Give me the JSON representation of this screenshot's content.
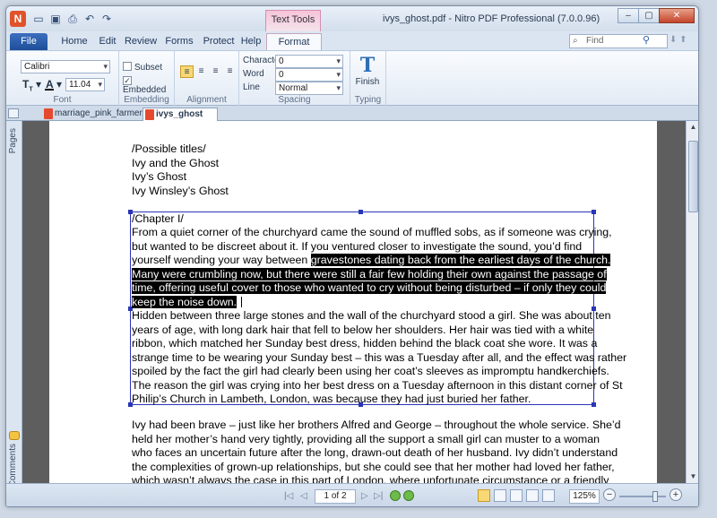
{
  "window": {
    "title": "ivys_ghost.pdf - Nitro PDF Professional (7.0.0.96)",
    "context_tab_header": "Text Tools",
    "controls": [
      "–",
      "▢",
      "✕"
    ]
  },
  "quick_access": [
    "folder-icon",
    "save-icon",
    "print-icon",
    "undo-icon",
    "redo-icon"
  ],
  "ribbon_tabs": [
    {
      "label": "File"
    },
    {
      "label": "Home"
    },
    {
      "label": "Edit"
    },
    {
      "label": "Review"
    },
    {
      "label": "Forms"
    },
    {
      "label": "Protect"
    },
    {
      "label": "Help"
    },
    {
      "label": "Format"
    }
  ],
  "search": {
    "placeholder": "Find"
  },
  "ribbon": {
    "font": {
      "name": "Calibri",
      "size": "11.04",
      "label": "Font"
    },
    "embedding": {
      "subset": "Subset",
      "embedded": "Embedded",
      "label": "Embedding"
    },
    "alignment": {
      "label": "Alignment"
    },
    "spacing": {
      "character_label": "Character",
      "character_value": "0",
      "word_label": "Word",
      "word_value": "0",
      "line_label": "Line",
      "line_value": "Normal",
      "label": "Spacing"
    },
    "typing": {
      "finish": "Finish",
      "label": "Typing"
    }
  },
  "doc_tabs": [
    {
      "label": "marriage_pink_farmer"
    },
    {
      "label": "ivys_ghost"
    }
  ],
  "side_panel": {
    "pages": "Pages",
    "comments": "Comments"
  },
  "document": {
    "lines": [
      {
        "text": "/Possible titles/"
      },
      {
        "text": "Ivy and the Ghost"
      },
      {
        "text": "Ivy’s Ghost"
      },
      {
        "text": "Ivy Winsley’s Ghost"
      },
      {
        "text": "/Chapter I/"
      },
      {
        "text": "From a quiet corner of the churchyard came the sound of muffled sobs, as if someone was crying,"
      },
      {
        "text": "but wanted to be discreet about it. If you ventured closer to investigate the sound, you’d find"
      },
      {
        "pre": "yourself wending your way between ",
        "hl": "gravestones dating back from the earliest days of the church."
      },
      {
        "hl": "Many were crumbling now, but there were still a fair few holding their own against the passage of"
      },
      {
        "hl": "time, offering useful cover to those who wanted to cry without being disturbed – if only they could"
      },
      {
        "hl": "keep the noise down."
      },
      {
        "text": "Hidden between three large stones and the wall of the churchyard stood a girl. She was about ten"
      },
      {
        "text": "years of age, with long dark hair that fell to below her shoulders. Her hair was tied with a white"
      },
      {
        "text": "ribbon, which matched her Sunday best dress, hidden behind the black coat she wore. It was a"
      },
      {
        "text": "strange time to be wearing your Sunday best – this was a Tuesday after all, and the effect was rather"
      },
      {
        "text": "spoiled by the fact the girl had clearly been using her coat’s sleeves as impromptu handkerchiefs."
      },
      {
        "text": "The reason the girl was crying into her best dress on a Tuesday afternoon in this distant corner of St"
      },
      {
        "text": "Philip’s Church in Lambeth, London, was because they had just buried her father."
      },
      {
        "text": "Ivy had been brave – just like her brothers Alfred and George – throughout the whole service. She’d"
      },
      {
        "text": "held her mother’s hand very tightly, providing all the support a small girl can muster to a woman"
      },
      {
        "text": "who faces an uncertain future after the long, drawn-out death of her husband. Ivy didn’t understand"
      },
      {
        "text": "the complexities of grown-up relationships, but she could see that her mother had loved her father,"
      },
      {
        "text": "which wasn’t always the case in this part of London, where unfortunate circumstance or a friendly"
      }
    ]
  },
  "status": {
    "page": "1 of 2",
    "zoom": "125%",
    "zoom_level": 0.8
  }
}
